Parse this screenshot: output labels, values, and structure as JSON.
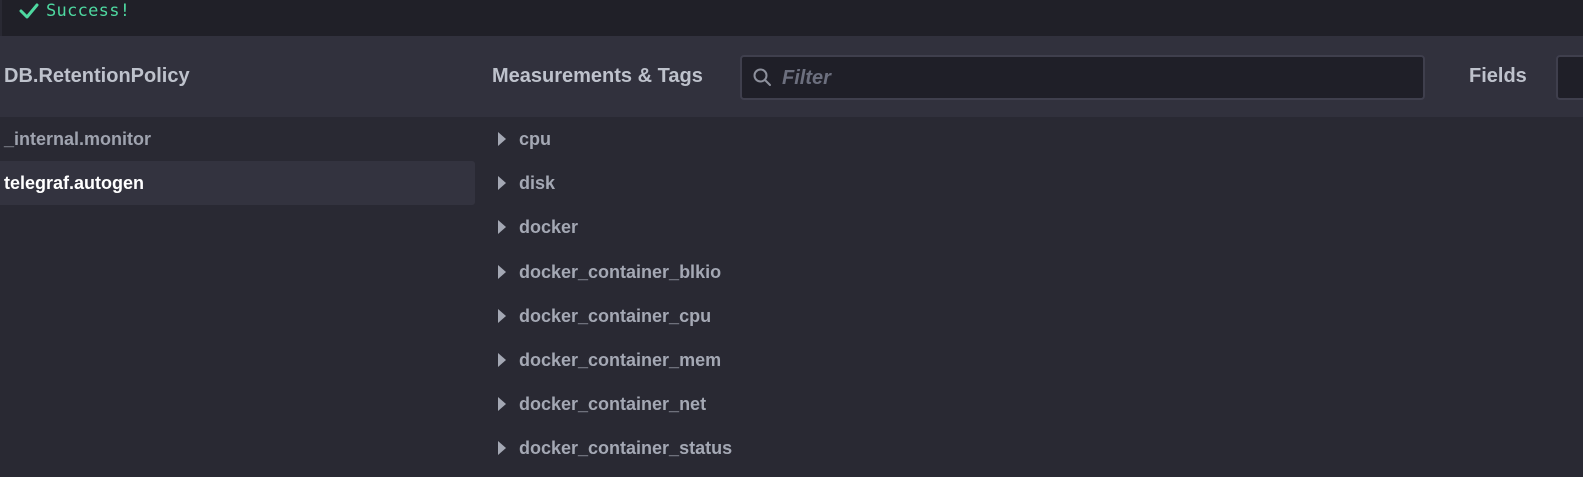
{
  "status": {
    "icon": "check-icon",
    "text": "Success!",
    "color": "#4ed8a0"
  },
  "columns": {
    "db_title": "DB.RetentionPolicy",
    "measurements_title": "Measurements & Tags",
    "fields_title": "Fields"
  },
  "filter": {
    "placeholder": "Filter",
    "value": ""
  },
  "databases": [
    {
      "label": "_internal.monitor",
      "active": false
    },
    {
      "label": "telegraf.autogen",
      "active": true
    }
  ],
  "measurements": [
    {
      "label": "cpu"
    },
    {
      "label": "disk"
    },
    {
      "label": "docker"
    },
    {
      "label": "docker_container_blkio"
    },
    {
      "label": "docker_container_cpu"
    },
    {
      "label": "docker_container_mem"
    },
    {
      "label": "docker_container_net"
    },
    {
      "label": "docker_container_status"
    }
  ]
}
